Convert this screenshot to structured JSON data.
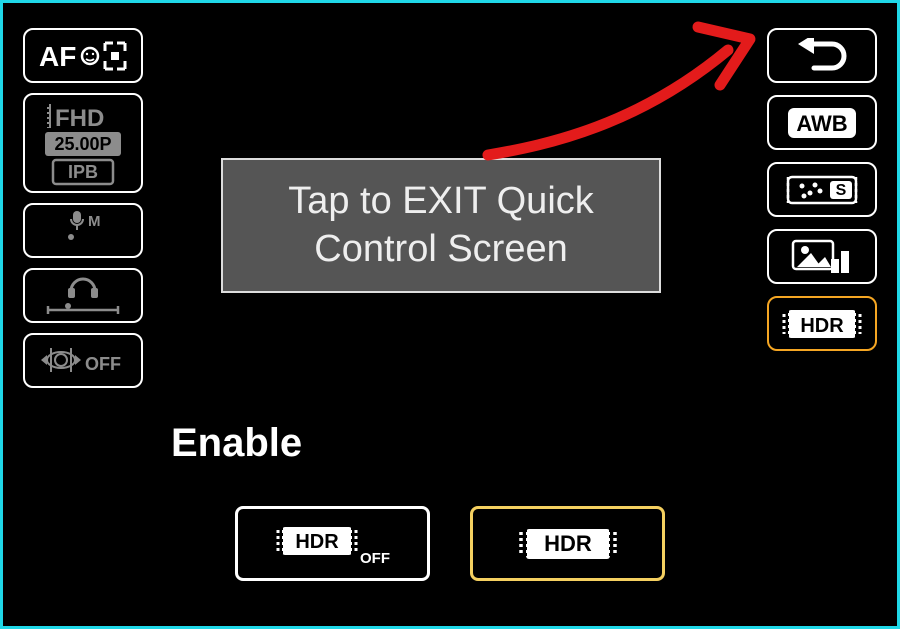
{
  "annotation": {
    "text": "Tap to EXIT Quick Control Screen"
  },
  "status_label": "Enable",
  "left": {
    "af": {
      "label": "AF",
      "icon": "face-tracking"
    },
    "video": {
      "res": "FHD",
      "fps": "25.00P",
      "codec": "IPB"
    },
    "mic": {
      "label": "M"
    },
    "headphone": {},
    "is": {
      "label": "OFF"
    }
  },
  "right": {
    "return": {},
    "wb": {
      "label": "AWB"
    },
    "picture_style": {
      "label": "S"
    },
    "creative_assist": {},
    "hdr": {
      "label": "HDR"
    }
  },
  "options": {
    "off": {
      "label": "HDR",
      "suffix": "OFF"
    },
    "on": {
      "label": "HDR"
    }
  },
  "colors": {
    "frame": "#1fd8e8",
    "selected": "#f5a623",
    "selected_light": "#f5d060",
    "annotation_arrow": "#e31b1b"
  }
}
